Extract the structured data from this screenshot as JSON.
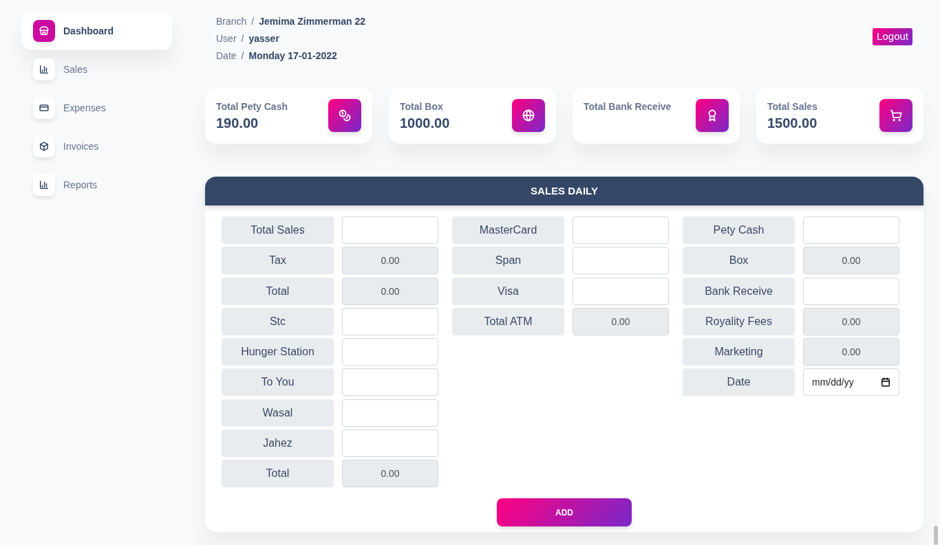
{
  "sidebar": {
    "items": [
      {
        "label": "Dashboard",
        "selected": true
      },
      {
        "label": "Sales",
        "selected": false
      },
      {
        "label": "Expenses",
        "selected": false
      },
      {
        "label": "Invoices",
        "selected": false
      },
      {
        "label": "Reports",
        "selected": false
      }
    ]
  },
  "header": {
    "fields": [
      {
        "label": "Branch",
        "separator": "/",
        "value": "Jemima Zimmerman 22"
      },
      {
        "label": "User",
        "separator": "/",
        "value": "yasser"
      },
      {
        "label": "Date",
        "separator": "/",
        "value": "Monday 17-01-2022"
      }
    ],
    "logout_button": "Logout"
  },
  "stat_cards": [
    {
      "title": "Total Pety Cash",
      "value": "190.00"
    },
    {
      "title": "Total Box",
      "value": "1000.00"
    },
    {
      "title": "Total Bank Receive"
    },
    {
      "title": "Total Sales",
      "value": "1500.00"
    }
  ],
  "sales_daily": {
    "title": "SALES DAILY",
    "columns": [
      {
        "rows": [
          {
            "label": "Total Sales",
            "kind": "input"
          },
          {
            "label": "Tax",
            "kind": "readonly",
            "value": "0.00"
          },
          {
            "label": "Total",
            "kind": "readonly",
            "value": "0.00"
          },
          {
            "label": "Stc",
            "kind": "input"
          },
          {
            "label": "Hunger Station",
            "kind": "input"
          },
          {
            "label": "To You",
            "kind": "input"
          },
          {
            "label": "Wasal",
            "kind": "input"
          },
          {
            "label": "Jahez",
            "kind": "input"
          },
          {
            "label": "Total",
            "kind": "readonly",
            "value": "0.00"
          }
        ]
      },
      {
        "rows": [
          {
            "label": "MasterCard",
            "kind": "input"
          },
          {
            "label": "Span",
            "kind": "input"
          },
          {
            "label": "Visa",
            "kind": "input"
          },
          {
            "label": "Total ATM",
            "kind": "readonly",
            "value": "0.00"
          }
        ]
      },
      {
        "rows": [
          {
            "label": "Pety Cash",
            "kind": "input"
          },
          {
            "label": "Box",
            "kind": "readonly",
            "value": "0.00"
          },
          {
            "label": "Bank Receive",
            "kind": "input"
          },
          {
            "label": "Royality Fees",
            "kind": "readonly",
            "value": "0.00"
          },
          {
            "label": "Marketing",
            "kind": "readonly",
            "value": "0.00"
          },
          {
            "label": "Date",
            "kind": "date",
            "placeholder": "mm/dd/yy"
          }
        ]
      }
    ],
    "add_button": "ADD"
  }
}
